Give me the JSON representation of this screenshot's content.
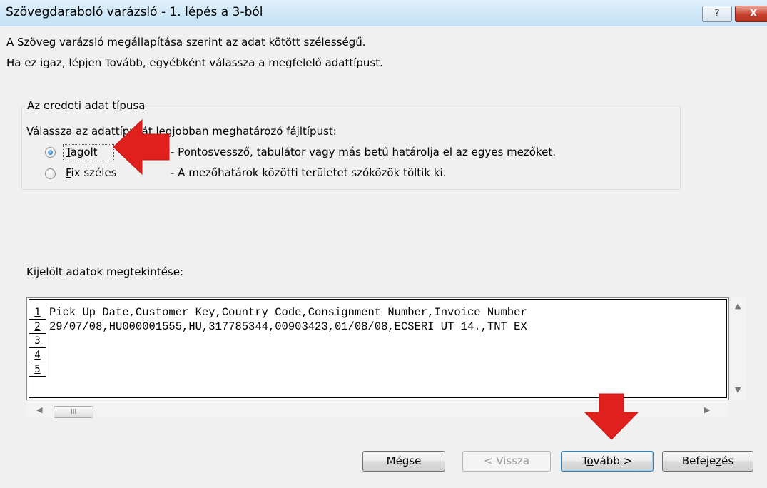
{
  "window": {
    "title": "Szövegdaraboló varázsló - 1. lépés a 3-ból",
    "help_label": "?",
    "close_label": "X"
  },
  "intro": {
    "line1": "A Szöveg varázsló megállapítása szerint az adat kötött szélességű.",
    "line2": "Ha ez igaz, lépjen Tovább, egyébként válassza a megfelelő adattípust."
  },
  "data_type_group": {
    "legend": "Az eredeti adat típusa",
    "prompt": "Válassza az adattípusát legjobban meghatározó fájltípust:",
    "options": [
      {
        "label_first": "T",
        "label_rest": "agolt",
        "description": "- Pontosvessző, tabulátor vagy más betű határolja el az egyes mezőket.",
        "selected": true
      },
      {
        "label_first": "F",
        "label_rest": "ix széles",
        "description": "- A mezőhatárok közötti területet szóközök töltik ki.",
        "selected": false
      }
    ]
  },
  "preview": {
    "label": "Kijelölt adatok megtekintése:",
    "rows": [
      {
        "num": "1",
        "text": "Pick Up Date,Customer Key,Country Code,Consignment Number,Invoice Number"
      },
      {
        "num": "2",
        "text": "29/07/08,HU000001555,HU,317785344,00903423,01/08/08,ECSERI UT 14.,TNT EX"
      },
      {
        "num": "3",
        "text": ""
      },
      {
        "num": "4",
        "text": ""
      },
      {
        "num": "5",
        "text": ""
      }
    ],
    "hscroll_thumb": "III"
  },
  "buttons": {
    "cancel": "Mégse",
    "back": "< Vissza",
    "next_pre": "T",
    "next_u": "o",
    "next_post": "vább >",
    "finish_pre": "Befeje",
    "finish_u": "z",
    "finish_post": "és"
  },
  "colors": {
    "arrow": "#e0201c",
    "titlebar": "#c4e1f4"
  }
}
